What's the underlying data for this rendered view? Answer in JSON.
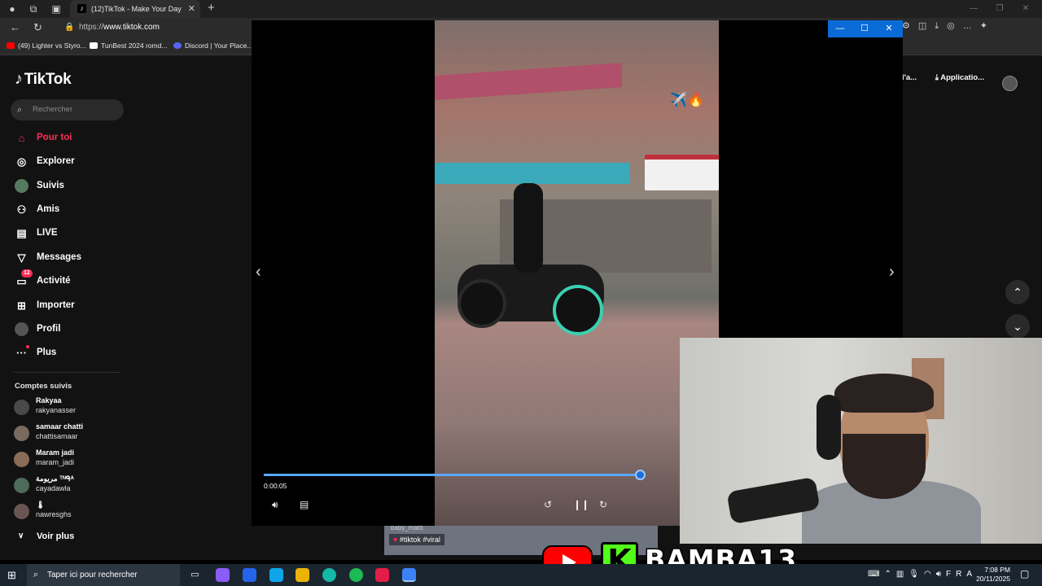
{
  "browser": {
    "tab_title": "(12)TikTok - Make Your Day",
    "url_prefix": "https://",
    "url_host": "www.tiktok.com",
    "bookmarks": [
      "(49) Lighter vs Styro...",
      "TunBest 2024 romd...",
      "Discord | Your Place..."
    ]
  },
  "tiktok": {
    "logo": "TikTok",
    "search_placeholder": "Rechercher",
    "nav": [
      {
        "label": "Pour toi",
        "icon": "home-icon"
      },
      {
        "label": "Explorer",
        "icon": "compass-icon"
      },
      {
        "label": "Suivis",
        "icon": "following-avatar-icon"
      },
      {
        "label": "Amis",
        "icon": "friends-icon"
      },
      {
        "label": "LIVE",
        "icon": "live-tv-icon"
      },
      {
        "label": "Messages",
        "icon": "send-icon"
      },
      {
        "label": "Activité",
        "icon": "inbox-icon",
        "badge": "12"
      },
      {
        "label": "Importer",
        "icon": "upload-icon"
      },
      {
        "label": "Profil",
        "icon": "profile-avatar-icon"
      },
      {
        "label": "Plus",
        "icon": "more-dots-icon"
      }
    ],
    "followed_title": "Comptes suivis",
    "followed": [
      {
        "name": "Rakyaa",
        "username": "rakyanasser"
      },
      {
        "name": "samaar chatti",
        "username": "chattisamaar"
      },
      {
        "name": "Maram jadi",
        "username": "maram_jadi"
      },
      {
        "name": "مريومة ᵀᴺᑫᴬ",
        "username": "cayadawla"
      },
      {
        "name": "🌡",
        "username": "nawresghs"
      }
    ],
    "see_more": "Voir plus",
    "top_right": {
      "partial": "l'a...",
      "apps": "Applicatio..."
    }
  },
  "player": {
    "time": "0:00:05",
    "progress": 0.96,
    "stickers": "✈️🔥",
    "caption_tags": "#tiktok  #viral",
    "caption_user": "baby_mattt"
  },
  "overlay": {
    "channel": "BAMBA13",
    "kick_letter": "K"
  },
  "taskbar": {
    "search": "Taper ici pour rechercher",
    "lang": "FRA",
    "time": "7:08 PM",
    "date": "20/11/2025"
  },
  "colors": {
    "accent": "#fe2c55",
    "player_bar": "#0b6bd6",
    "kick": "#53fc18",
    "youtube": "#ff0000"
  }
}
